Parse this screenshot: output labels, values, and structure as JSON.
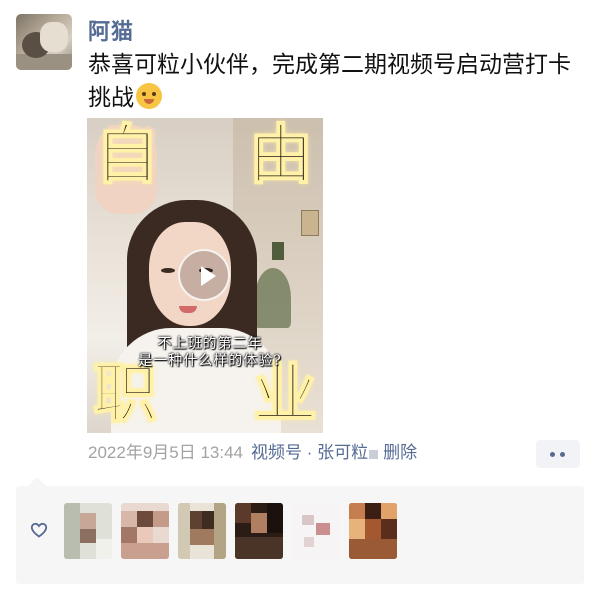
{
  "post": {
    "author": "阿猫",
    "text": "恭喜可粒小伙伴，完成第二期视频号启动营打卡挑战",
    "emoji": "shushing-face-emoji"
  },
  "video": {
    "overlay_chars": [
      "自",
      "由",
      "职",
      "业"
    ],
    "caption_line1": "不上班的第二年",
    "caption_line2": "是一种什么样的体验?"
  },
  "meta": {
    "timestamp": "2022年9月5日 13:44",
    "channel_label": "视频号 · 张可粒",
    "delete_label": "删除"
  },
  "likes": {
    "icon": "heart-outline-icon",
    "count_shown": 6
  },
  "colors": {
    "link": "#566b93",
    "timestamp": "#a3a3a3",
    "likes_bg": "#f6f6f6"
  }
}
